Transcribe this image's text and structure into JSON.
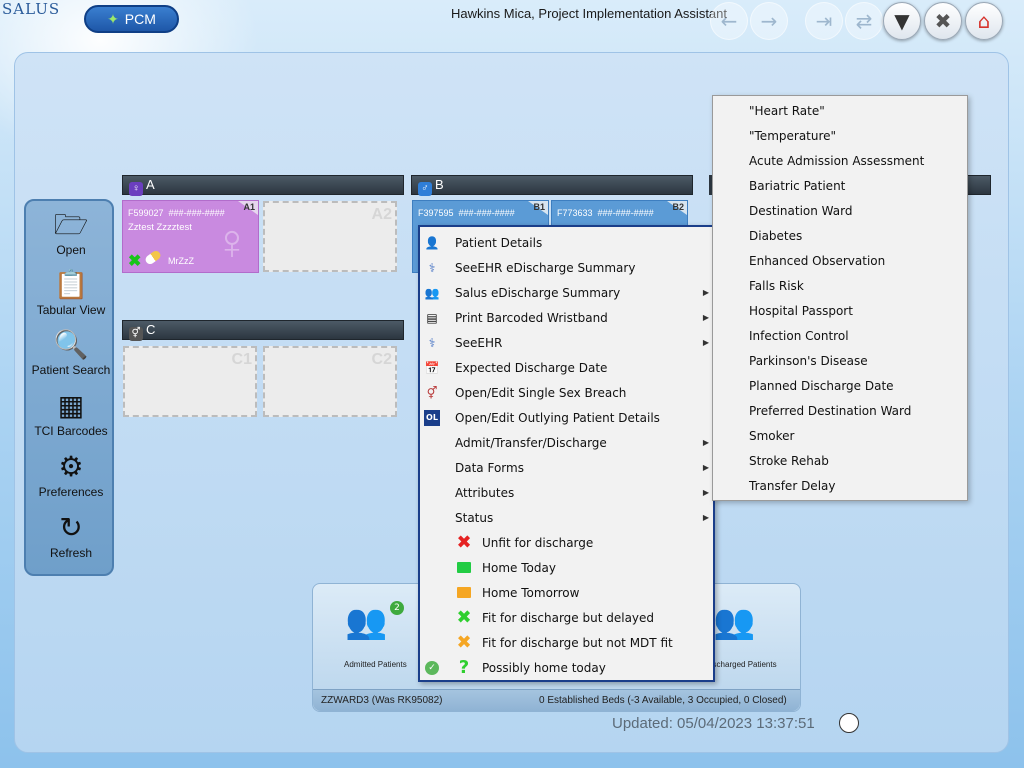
{
  "app": {
    "logo": "SALUS",
    "module_label": "PCM",
    "user_title": "Hawkins Mica, Project Implementation Assistant"
  },
  "toolbar": {
    "buttons": [
      {
        "name": "back-arrow-icon",
        "glyph": "←",
        "state": "disabled"
      },
      {
        "name": "forward-arrow-icon",
        "glyph": "→",
        "state": "disabled"
      },
      {
        "name": "exit-door-icon",
        "glyph": "⇥",
        "state": "disabled"
      },
      {
        "name": "transfer-icon",
        "glyph": "⇄",
        "state": "disabled"
      },
      {
        "name": "filter-icon",
        "glyph": "▼",
        "state": "enabled"
      },
      {
        "name": "close-icon",
        "glyph": "✖",
        "state": "enabled"
      },
      {
        "name": "home-icon",
        "glyph": "⌂",
        "state": "enabled"
      }
    ]
  },
  "sidebar": {
    "items": [
      {
        "label": "Open",
        "icon": "folder-icon",
        "glyph": "📂"
      },
      {
        "label": "Tabular View",
        "icon": "clipboard-icon",
        "glyph": "📋"
      },
      {
        "label": "Patient Search",
        "icon": "magnifier-icon",
        "glyph": "🔍"
      },
      {
        "label": "TCI Barcodes",
        "icon": "qr-code-icon",
        "glyph": "▦"
      },
      {
        "label": "Preferences",
        "icon": "gear-icon",
        "glyph": "⚙"
      },
      {
        "label": "Refresh",
        "icon": "refresh-icon",
        "glyph": "↻"
      }
    ]
  },
  "bays": {
    "A": {
      "title": "A",
      "beds": {
        "A1": {
          "label": "A1",
          "patient_id": "F599027",
          "masked": "###-###-####",
          "name": "Zztest Zzzztest",
          "tag": "MrZzZ"
        },
        "A2": {
          "label": "A2"
        }
      }
    },
    "B": {
      "title": "B",
      "beds": {
        "B1": {
          "label": "B1",
          "patient_id": "F397595",
          "masked": "###-###-####"
        },
        "B2": {
          "label": "B2",
          "patient_id": "F773633",
          "masked": "###-###-####"
        }
      }
    },
    "C": {
      "title": "C",
      "beds": {
        "C1": {
          "label": "C1"
        },
        "C2": {
          "label": "C2"
        }
      }
    }
  },
  "context_menu": {
    "items": [
      {
        "label": "Patient Details",
        "icon": "person-icon",
        "glyph": "👤",
        "submenu": false
      },
      {
        "label": "SeeEHR eDischarge Summary",
        "icon": "ehr-icon",
        "glyph": "⚕",
        "submenu": false
      },
      {
        "label": "Salus eDischarge Summary",
        "icon": "salus-icon",
        "glyph": "👥",
        "submenu": true
      },
      {
        "label": "Print Barcoded Wristband",
        "icon": "barcode-icon",
        "glyph": "▤",
        "submenu": true
      },
      {
        "label": "SeeEHR",
        "icon": "ehr-icon",
        "glyph": "⚕",
        "submenu": true
      },
      {
        "label": "Expected Discharge Date",
        "icon": "calendar-icon",
        "glyph": "📅",
        "submenu": false
      },
      {
        "label": "Open/Edit Single Sex Breach",
        "icon": "sex-breach-icon",
        "glyph": "⚥",
        "submenu": false
      },
      {
        "label": "Open/Edit Outlying Patient Details",
        "icon": "outlier-icon",
        "glyph": "OL",
        "submenu": false
      },
      {
        "label": "Admit/Transfer/Discharge",
        "icon": "",
        "glyph": "",
        "submenu": true
      },
      {
        "label": "Data Forms",
        "icon": "",
        "glyph": "",
        "submenu": true
      },
      {
        "label": "Attributes",
        "icon": "",
        "glyph": "",
        "submenu": true
      },
      {
        "label": "Status",
        "icon": "",
        "glyph": "",
        "submenu": true
      }
    ],
    "status_items": [
      {
        "label": "Unfit for discharge",
        "icon": "red-x-icon",
        "glyph": "✖",
        "color": "#e52222",
        "shape": "glyph",
        "checked": false
      },
      {
        "label": "Home Today",
        "icon": "green-square-icon",
        "glyph": "",
        "color": "#22cc44",
        "shape": "square",
        "checked": false
      },
      {
        "label": "Home Tomorrow",
        "icon": "orange-square-icon",
        "glyph": "",
        "color": "#f5a623",
        "shape": "square",
        "checked": false
      },
      {
        "label": "Fit for discharge but delayed",
        "icon": "green-x-icon",
        "glyph": "✖",
        "color": "#2fcf2f",
        "shape": "glyph",
        "checked": false
      },
      {
        "label": "Fit for discharge but not MDT fit",
        "icon": "orange-x-icon",
        "glyph": "✖",
        "color": "#f5a623",
        "shape": "glyph",
        "checked": false
      },
      {
        "label": "Possibly home today",
        "icon": "green-question-icon",
        "glyph": "?",
        "color": "#2fcf2f",
        "shape": "glyph",
        "checked": true
      }
    ]
  },
  "attributes_submenu": {
    "items": [
      "\"Heart Rate\"",
      "\"Temperature\"",
      "Acute Admission Assessment",
      "Bariatric Patient",
      "Destination Ward",
      "Diabetes",
      "Enhanced Observation",
      "Falls Risk",
      "Hospital Passport",
      "Infection Control",
      "Parkinson's Disease",
      "Planned Discharge Date",
      "Preferred Destination Ward",
      "Smoker",
      "Stroke Rehab",
      "Transfer Delay"
    ]
  },
  "stats": {
    "admitted_label": "Admitted Patients",
    "admitted_count": "2",
    "discharged_label": "Discharged Patients",
    "ward_text": "ZZWARD3 (Was RK95082)",
    "beds_text": "0 Established Beds (-3 Available, 3 Occupied, 0 Closed)"
  },
  "updated": "Updated: 05/04/2023 13:37:51"
}
